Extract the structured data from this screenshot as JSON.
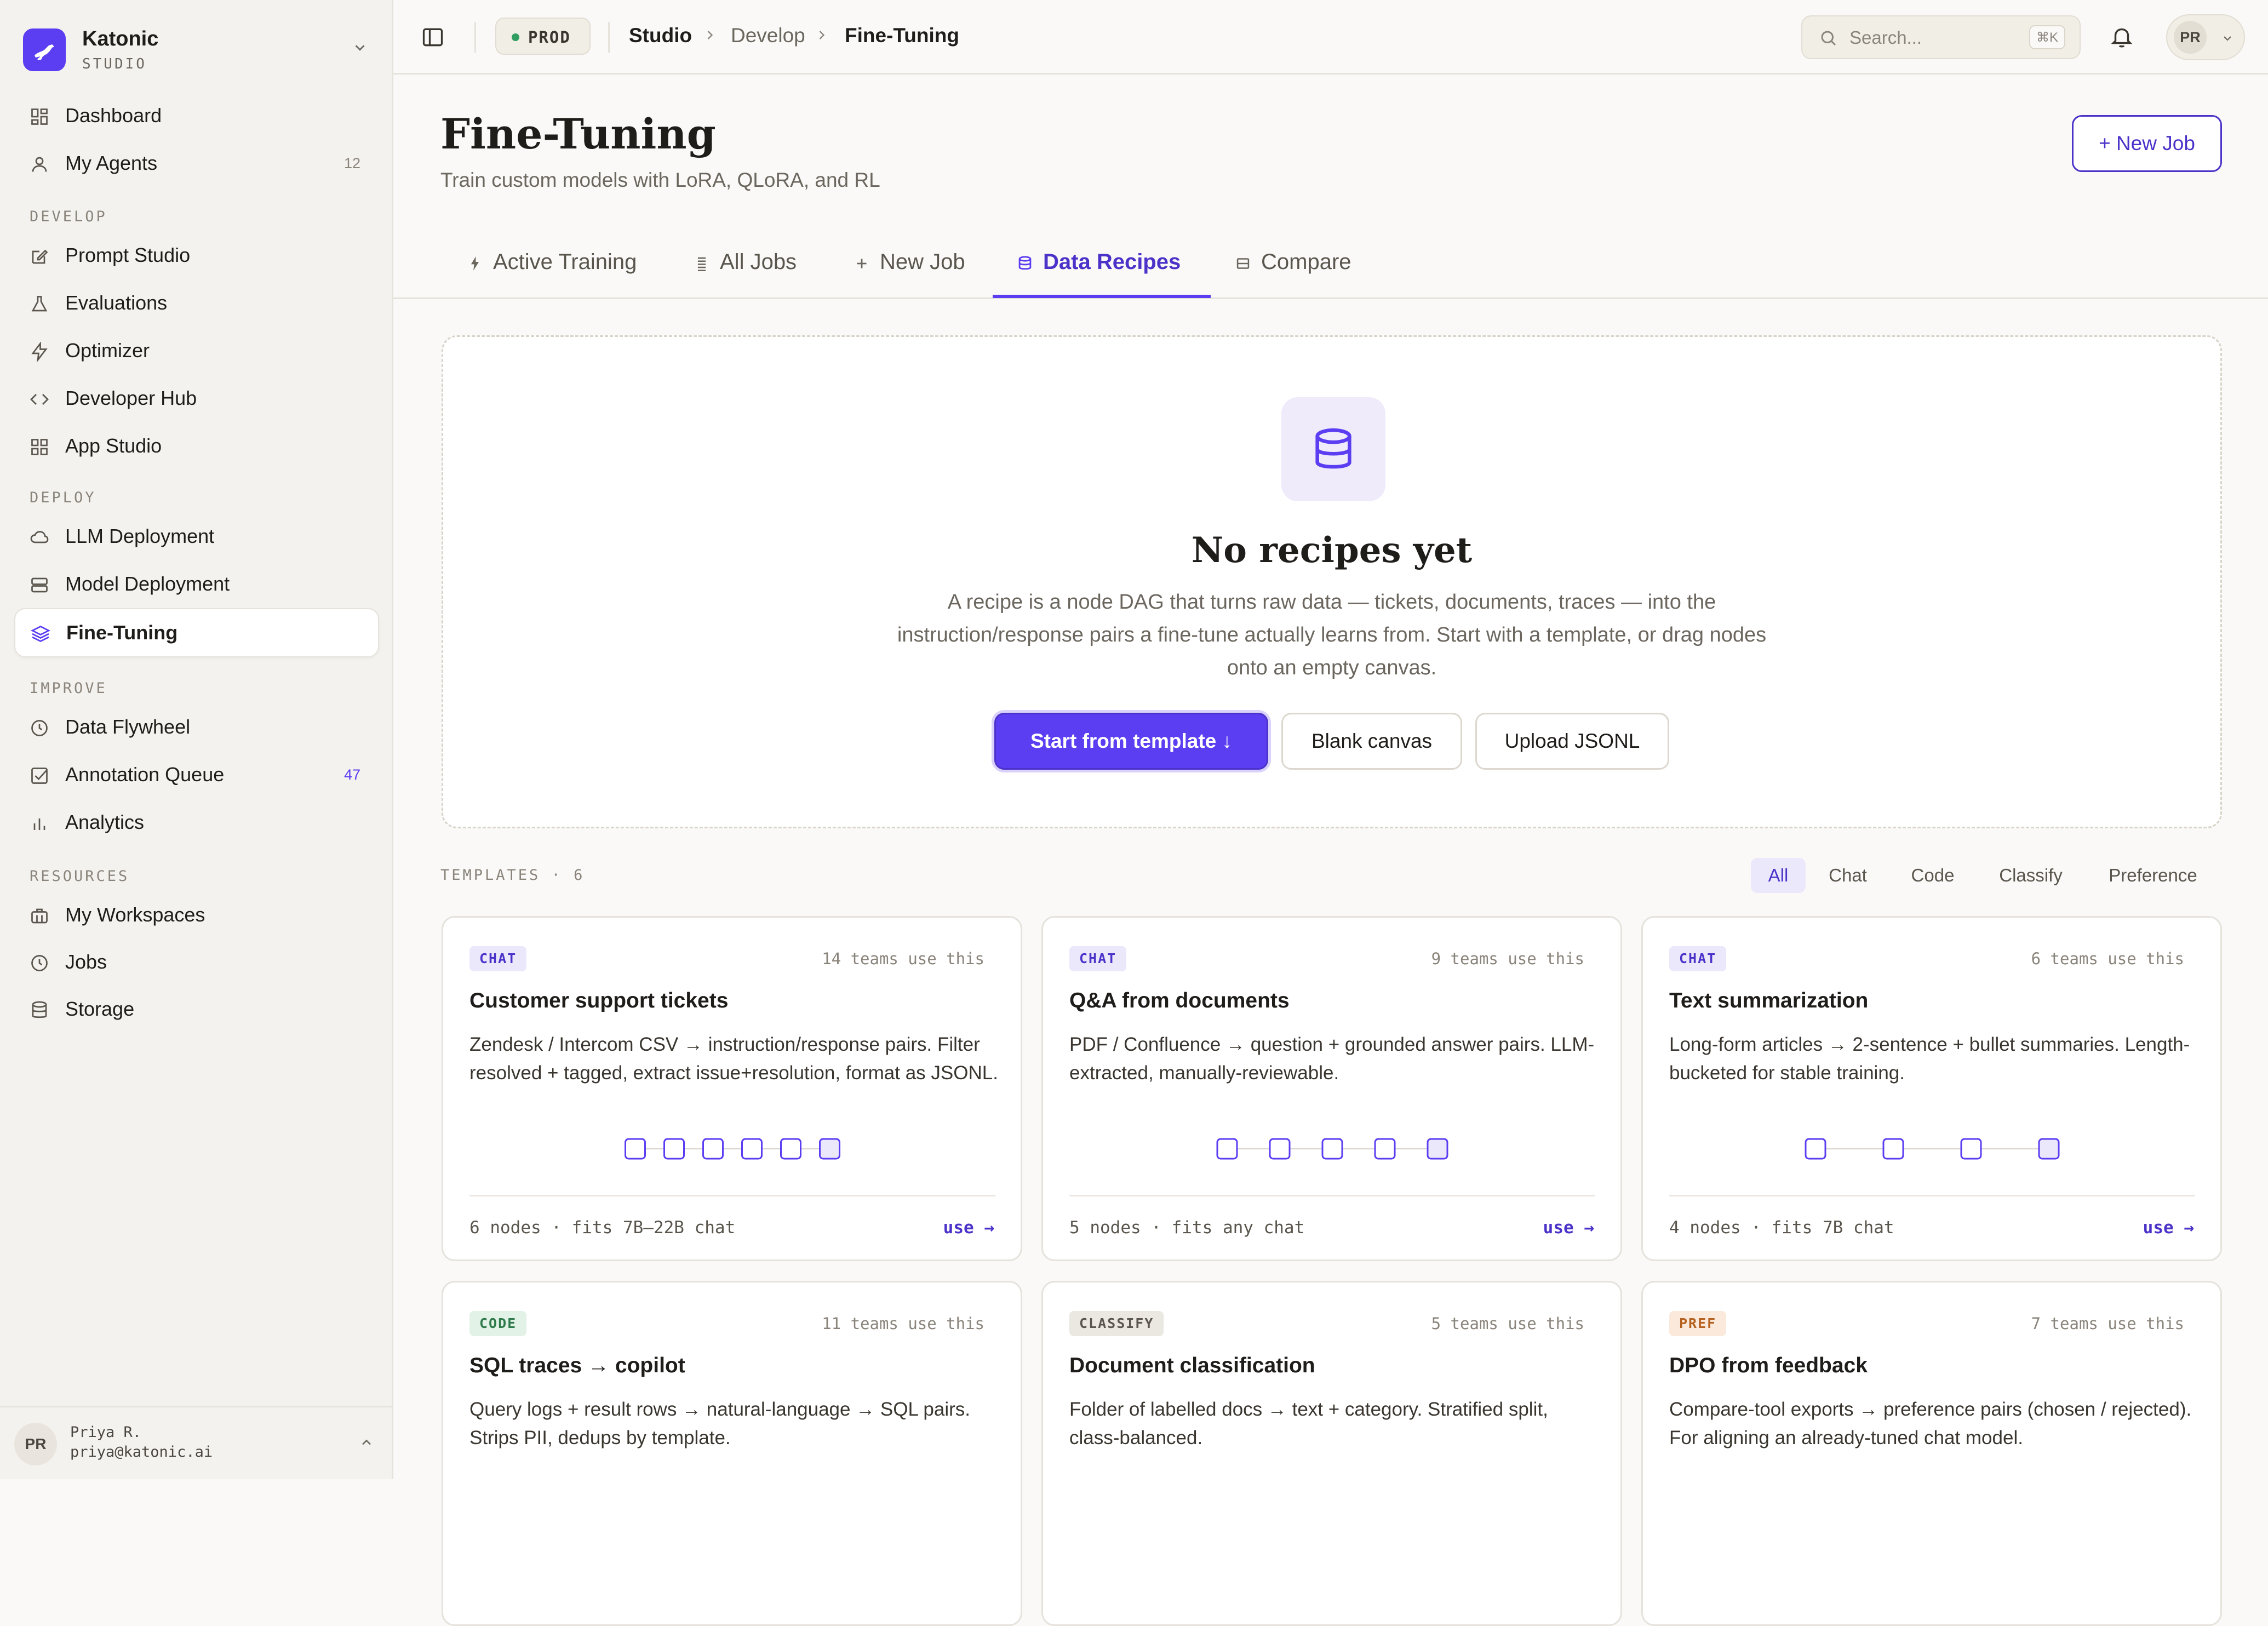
{
  "brand": {
    "name": "Katonic",
    "sub": "STUDIO"
  },
  "sidebar": {
    "items": [
      {
        "label": "Dashboard"
      },
      {
        "label": "My Agents",
        "count": "12"
      },
      {
        "label": "Prompt Studio"
      },
      {
        "label": "Evaluations"
      },
      {
        "label": "Optimizer"
      },
      {
        "label": "Developer Hub"
      },
      {
        "label": "App Studio"
      },
      {
        "label": "LLM Deployment"
      },
      {
        "label": "Model Deployment"
      },
      {
        "label": "Fine-Tuning"
      },
      {
        "label": "Data Flywheel"
      },
      {
        "label": "Annotation Queue",
        "count": "47"
      },
      {
        "label": "Analytics"
      },
      {
        "label": "My Workspaces"
      },
      {
        "label": "Jobs"
      },
      {
        "label": "Storage"
      }
    ],
    "sections": {
      "develop": "DEVELOP",
      "deploy": "DEPLOY",
      "improve": "IMPROVE",
      "resources": "RESOURCES"
    },
    "user": {
      "initials": "PR",
      "name": "Priya R.",
      "email": "priya@katonic.ai"
    }
  },
  "topbar": {
    "env": "PROD",
    "breadcrumb": [
      "Studio",
      "Develop",
      "Fine-Tuning"
    ],
    "search_placeholder": "Search...",
    "search_shortcut": "⌘K",
    "user_initials": "PR"
  },
  "page": {
    "title": "Fine-Tuning",
    "subtitle": "Train custom models with LoRA, QLoRA, and RL",
    "new_job_button": "+ New Job"
  },
  "tabs": [
    {
      "label": "Active Training",
      "icon": "bolt-icon"
    },
    {
      "label": "All Jobs",
      "icon": "list-icon"
    },
    {
      "label": "New Job",
      "icon": "plus-icon"
    },
    {
      "label": "Data Recipes",
      "icon": "database-icon",
      "active": true
    },
    {
      "label": "Compare",
      "icon": "columns-icon"
    }
  ],
  "empty_state": {
    "title": "No recipes yet",
    "description": "A recipe is a node DAG that turns raw data — tickets, documents, traces — into the instruction/response pairs a fine-tune actually learns from. Start with a template, or drag nodes onto an empty canvas.",
    "buttons": {
      "template": "Start from template ↓",
      "blank": "Blank canvas",
      "upload": "Upload JSONL"
    }
  },
  "templates": {
    "label": "TEMPLATES · 6",
    "filters": [
      "All",
      "Chat",
      "Code",
      "Classify",
      "Preference"
    ],
    "active_filter": "All",
    "cards": [
      {
        "tag": "CHAT",
        "uses": "14 teams use this",
        "title": "Customer support tickets",
        "desc": "Zendesk / Intercom CSV → instruction/response pairs. Filter resolved + tagged, extract issue+resolution, format as JSONL.",
        "nodes": 6,
        "meta": "6 nodes · fits 7B–22B chat",
        "use": "use →"
      },
      {
        "tag": "CHAT",
        "uses": "9 teams use this",
        "title": "Q&A from documents",
        "desc": "PDF / Confluence → question + grounded answer pairs. LLM-extracted, manually-reviewable.",
        "nodes": 5,
        "meta": "5 nodes · fits any chat",
        "use": "use →"
      },
      {
        "tag": "CHAT",
        "uses": "6 teams use this",
        "title": "Text summarization",
        "desc": "Long-form articles → 2-sentence + bullet summaries. Length-bucketed for stable training.",
        "nodes": 4,
        "meta": "4 nodes · fits 7B chat",
        "use": "use →"
      },
      {
        "tag": "CODE",
        "uses": "11 teams use this",
        "title": "SQL traces → copilot",
        "desc": "Query logs + result rows → natural-language → SQL pairs. Strips PII, dedups by template."
      },
      {
        "tag": "CLASSIFY",
        "uses": "5 teams use this",
        "title": "Document classification",
        "desc": "Folder of labelled docs → text + category. Stratified split, class-balanced."
      },
      {
        "tag": "PREF",
        "uses": "7 teams use this",
        "title": "DPO from feedback",
        "desc": "Compare-tool exports → preference pairs (chosen / rejected). For aligning an already-tuned chat model."
      }
    ]
  },
  "colors": {
    "accent": "#5b3ef2",
    "accent_dark": "#4b33c9",
    "env_dot": "#2f9e60"
  }
}
